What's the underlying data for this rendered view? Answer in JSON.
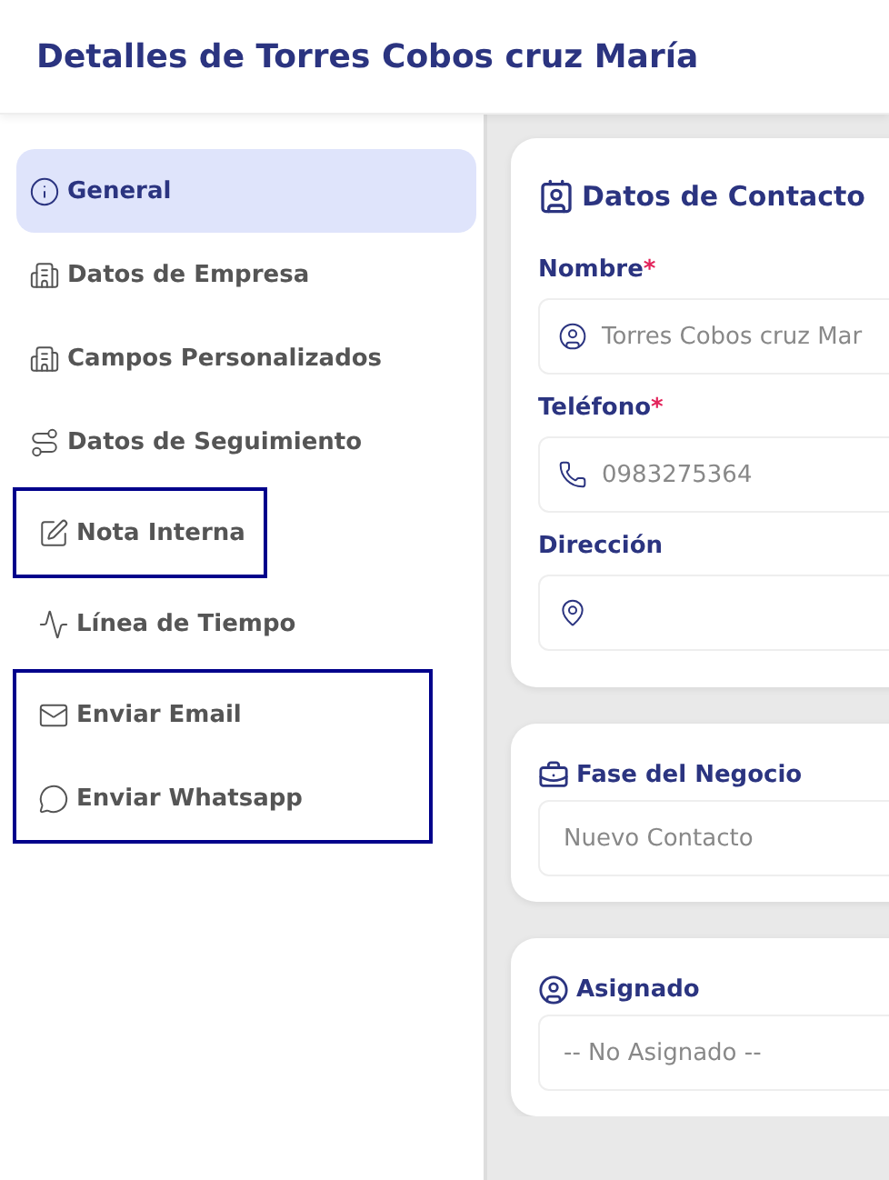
{
  "header": {
    "title": "Detalles de Torres Cobos cruz María"
  },
  "sidebar": {
    "groups": [
      {
        "outlined": false,
        "items": [
          {
            "label": "General",
            "selected": true
          },
          {
            "label": "Datos de Empresa",
            "selected": false
          },
          {
            "label": "Campos Personalizados",
            "selected": false
          },
          {
            "label": "Datos de Seguimiento",
            "selected": false
          }
        ]
      },
      {
        "outlined": true,
        "items": [
          {
            "label": "Nota Interna",
            "selected": false
          }
        ]
      },
      {
        "outlined": false,
        "items": [
          {
            "label": "Línea de Tiempo",
            "selected": false
          }
        ]
      },
      {
        "outlined": true,
        "items": [
          {
            "label": "Enviar Email",
            "selected": false
          },
          {
            "label": "Enviar Whatsapp",
            "selected": false
          }
        ]
      }
    ]
  },
  "contact_card": {
    "title": "Datos de Contacto",
    "fields": [
      {
        "label": "Nombre",
        "required_mark": "*",
        "value": "Torres Cobos cruz Mar"
      },
      {
        "label": "Teléfono",
        "required_mark": "*",
        "value": "0983275364"
      },
      {
        "label": "Dirección"
      }
    ]
  },
  "stage_card": {
    "title": "Fase del Negocio",
    "value": "Nuevo Contacto"
  },
  "assigned_card": {
    "title": "Asignado",
    "value": "-- No Asignado --"
  }
}
